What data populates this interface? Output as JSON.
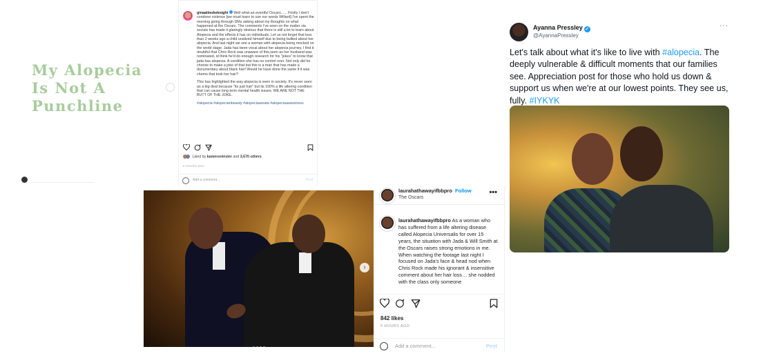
{
  "headline": {
    "lines": [
      "My Alopecia",
      "Is Not A",
      "Punchline"
    ],
    "color": "#a8cc9c"
  },
  "ig_post_1": {
    "username": "ginaatinukeknight",
    "para1": "Well what an eventful Oscars...... Firstly I don't condone violence [we must learn to use our words Willard] I've spent the morning going through DMs asking about my thoughts on what happened at the Oscars. The comments I've seen on the matter via socials has made it glaringly obvious that there is still a lot to learn about Alopecia and the effects it has on individuals. Let us not forget that less than 2 weeks ago a child unalived himself due to being bullied about her alopecia. And last night we see a woman with alopecia being mocked on the world stage. Jada has been vocal about her alopecia journey, I find it doubtful that Chris Rock was unaware of this,seen as her husband was nominated, id think he'd do enough research for his \"jokes\" to know that jada has alopecia. A condition she has no control over. Not only did he choose to make a joke of that but this is a man that has made a documentary about black hair! Would he have done the same if it was chemo that took her hair?",
    "para2": "This has highlighted the way alopecia is seen in society. It's never seen as a big deal because \"its just hair\" but its 100% a life altering condition that can cause long term mental health issues. WE ARE NOT THE BUTT OF THE JOKE.",
    "hashtags": "#alopecia #alopecianbeauty #alopeciaareata #alopeciaawareness",
    "likes_prefix": "Liked by",
    "likes_user": "kameronlester",
    "likes_and": "and",
    "likes_count": "3,570 others",
    "time": "9 HOURS AGO",
    "comment_placeholder": "Add a comment...",
    "post_label": "Post"
  },
  "ig_post_2": {
    "username": "laurahathawayifbbpro",
    "follow_label": "Follow",
    "location": "The Oscars",
    "more": "•••",
    "caption_user": "laurahathawayifbbpro",
    "caption": "As a woman who has suffered from a life altering disease called Alopecia Universalis for over 15 years, the situation with Jada & Will Smith at the Oscars raises strong emotions in me. When watching the footage last night I focused on Jada's face & head nod when Chris Rock made his ignorant & insensitive comment about her hair loss… she nodded with the class only someone",
    "likes": "842 likes",
    "time": "6 HOURS AGO",
    "comment_placeholder": "Add a comment...",
    "post_label": "Post"
  },
  "tweet": {
    "name": "Ayanna Pressley",
    "handle": "@AyannaPressley",
    "more": "···",
    "text_1": "Let's talk about what it's like to live with ",
    "hashtag_1": "#alopecia",
    "text_2": ". The deeply vulnerable & difficult moments that our families see. Appreciation post for those who hold us down & support us when we're at our lowest points. They see us, fully. ",
    "hashtag_2": "#IYKYK",
    "accent": "#1d9bf0"
  },
  "carousel": {
    "next_icon": "›",
    "dot_count": 4,
    "active_dot": 0
  }
}
